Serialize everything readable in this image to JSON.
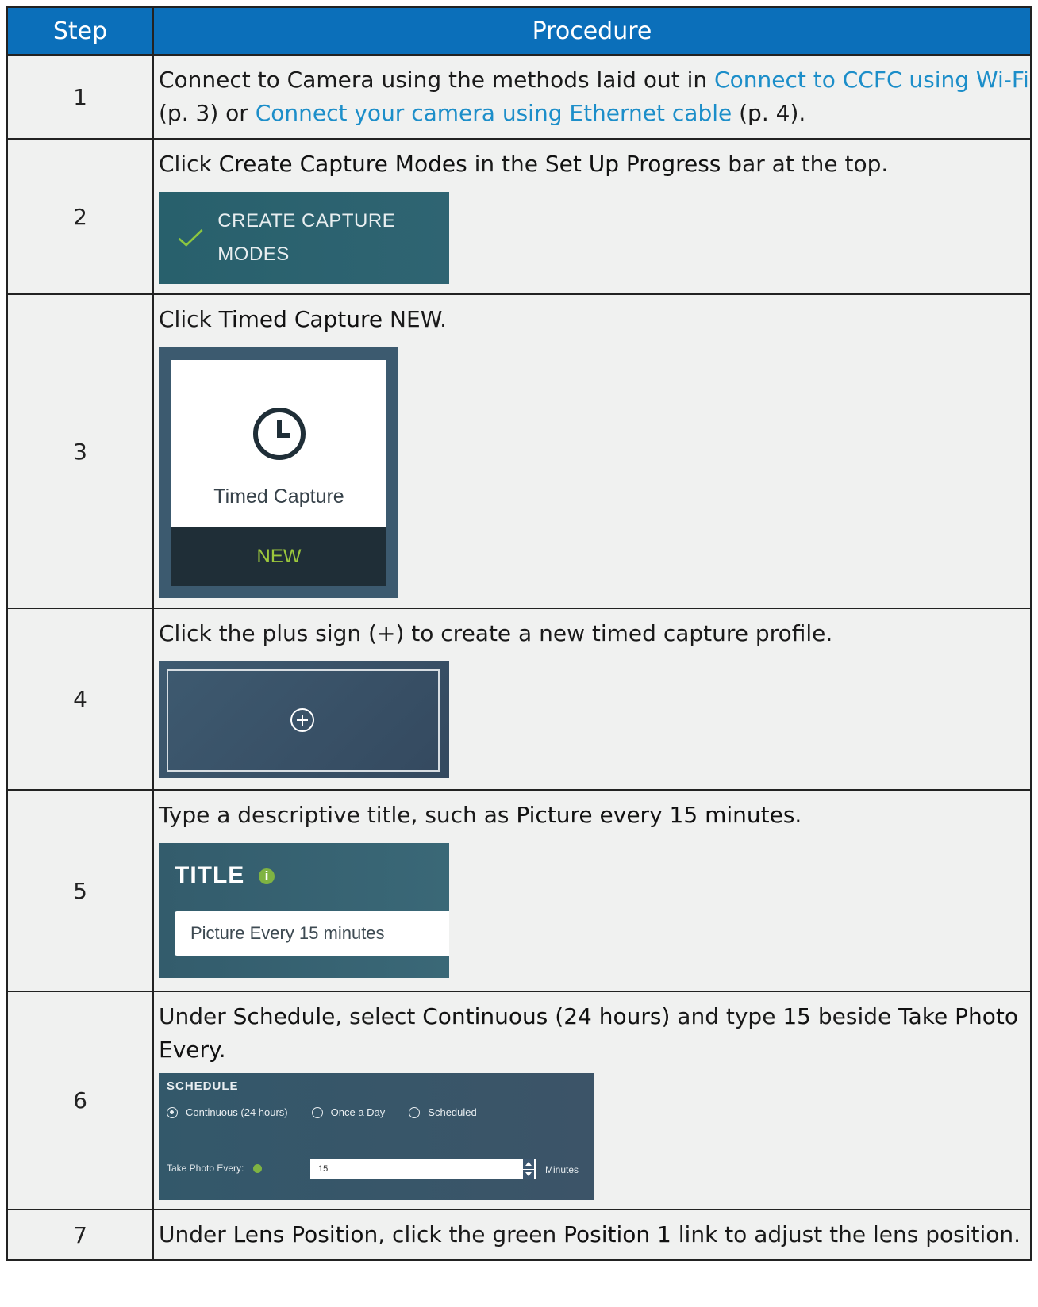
{
  "header": {
    "col_step": "Step",
    "col_procedure": "Procedure"
  },
  "rows": [
    {
      "step": "1",
      "t1": "Connect to Camera using the methods laid out in ",
      "link1": "Connect to CCFC using Wi-Fi",
      "t2": " (p. 3) or ",
      "link2": "Connect your camera using Ethernet cable",
      "t3": " (p. 4)."
    },
    {
      "step": "2",
      "t1": "Click ",
      "b1": "Create Capture Modes",
      "t2": " in the ",
      "b2": "Set Up Progress",
      "t3": " bar at the top.",
      "shot_label": "CREATE CAPTURE MODES"
    },
    {
      "step": "3",
      "t1": "Click ",
      "b1": "Timed Capture",
      "t2": " NEW.",
      "card_label": "Timed Capture",
      "card_footer": "NEW"
    },
    {
      "step": "4",
      "t1": "Click the plus sign (",
      "b1": "+",
      "t2": ") to create a new timed capture profile."
    },
    {
      "step": "5",
      "t1": "Type a descriptive title, such as ",
      "b1": "Picture every 15 minutes",
      "t2": ".",
      "field_label": "TITLE",
      "field_value": "Picture Every 15 minutes"
    },
    {
      "step": "6",
      "t1": "Under ",
      "b1": "Schedule",
      "t2": ", select ",
      "b2": "Continuous (24 hours)",
      "t3": " and type ",
      "b3": "15",
      "t4": " beside ",
      "b4": "Take Photo Every",
      "t5": ".",
      "panel": {
        "title": "SCHEDULE",
        "options": [
          "Continuous (24 hours)",
          "Once a Day",
          "Scheduled"
        ],
        "selected": "Continuous (24 hours)",
        "take_photo_label": "Take Photo Every:",
        "value": "15",
        "unit": "Minutes"
      }
    },
    {
      "step": "7",
      "t1": "Under ",
      "b1": "Lens Position",
      "t2": ", click the green ",
      "b2": "Position 1",
      "t3": " link to adjust the lens position."
    }
  ],
  "colors": {
    "header_bg": "#0b6fba",
    "link": "#1c8ec9",
    "accent_green": "#9cc83c"
  },
  "icons": [
    "check-icon",
    "clock-icon",
    "plus-circle-icon",
    "info-icon",
    "radio-icon",
    "spinner-icon"
  ]
}
